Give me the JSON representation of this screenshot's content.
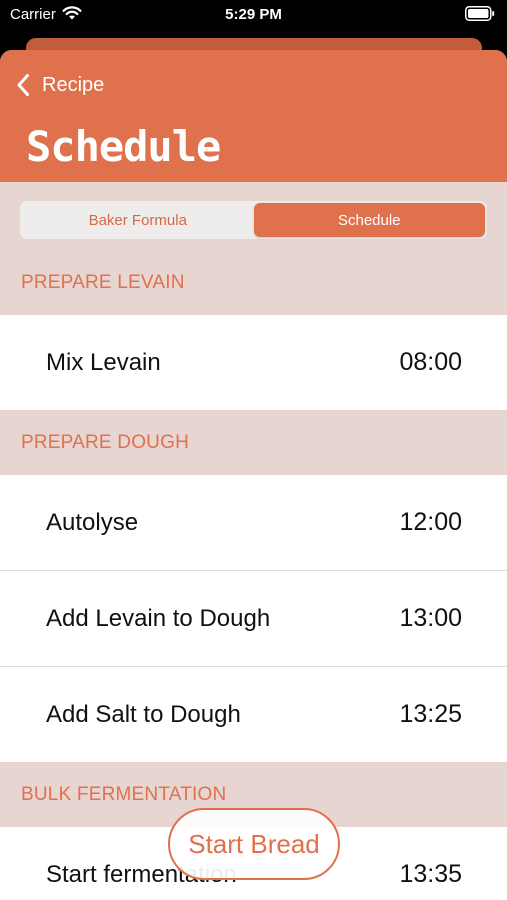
{
  "status_bar": {
    "carrier": "Carrier",
    "time": "5:29 PM"
  },
  "nav": {
    "back_label": "Recipe",
    "title": "Schedule"
  },
  "segmented": {
    "options": [
      "Baker Formula",
      "Schedule"
    ],
    "selected": "Schedule"
  },
  "sections": [
    {
      "header": "PREPARE LEVAIN",
      "items": [
        {
          "title": "Mix Levain",
          "time": "08:00"
        }
      ]
    },
    {
      "header": "PREPARE DOUGH",
      "items": [
        {
          "title": "Autolyse",
          "time": "12:00"
        },
        {
          "title": "Add Levain to Dough",
          "time": "13:00"
        },
        {
          "title": "Add Salt to Dough",
          "time": "13:25"
        }
      ]
    },
    {
      "header": "BULK FERMENTATION",
      "items": [
        {
          "title": "Start fermentation",
          "time": "13:35"
        }
      ]
    }
  ],
  "floating_button": {
    "label": "Start Bread"
  },
  "colors": {
    "accent": "#e0714d",
    "section_background": "#e6d5d0",
    "segment_background": "#efedeb"
  }
}
